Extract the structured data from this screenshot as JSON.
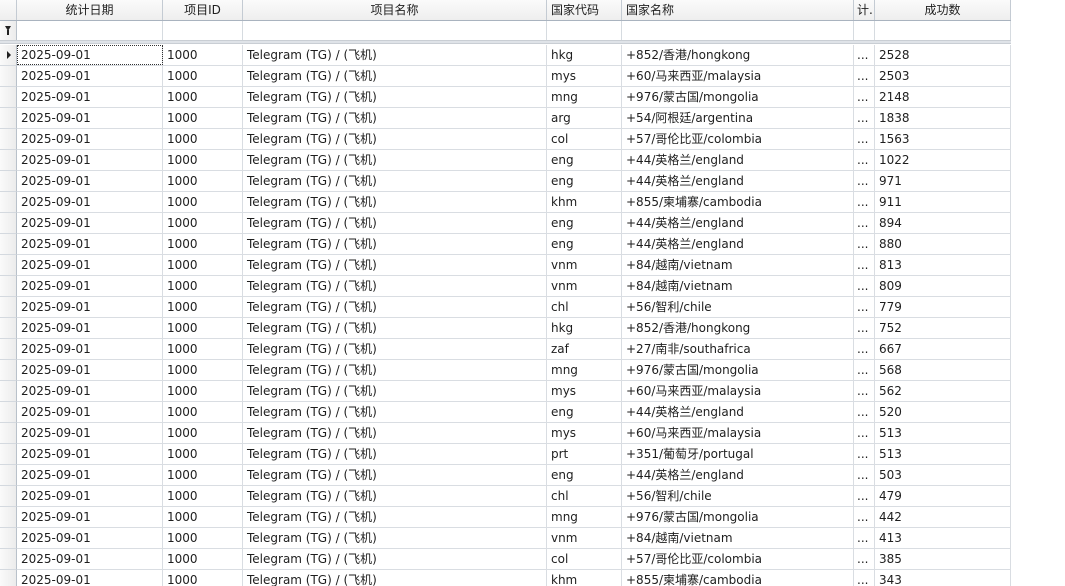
{
  "columns": [
    {
      "key": "date",
      "label": "统计日期"
    },
    {
      "key": "project_id",
      "label": "项目ID"
    },
    {
      "key": "project_name",
      "label": "项目名称"
    },
    {
      "key": "country_code",
      "label": "国家代码"
    },
    {
      "key": "country_name",
      "label": "国家名称"
    },
    {
      "key": "extra",
      "label": "计.."
    },
    {
      "key": "success",
      "label": "成功数"
    }
  ],
  "rows": [
    {
      "date": "2025-09-01",
      "project_id": "1000",
      "project_name": "Telegram (TG) / (飞机)",
      "country_code": "hkg",
      "country_name": "+852/香港/hongkong",
      "extra": "...",
      "success": "2528"
    },
    {
      "date": "2025-09-01",
      "project_id": "1000",
      "project_name": "Telegram (TG) / (飞机)",
      "country_code": "mys",
      "country_name": "+60/马来西亚/malaysia",
      "extra": "...",
      "success": "2503"
    },
    {
      "date": "2025-09-01",
      "project_id": "1000",
      "project_name": "Telegram (TG) / (飞机)",
      "country_code": "mng",
      "country_name": "+976/蒙古国/mongolia",
      "extra": "...",
      "success": "2148"
    },
    {
      "date": "2025-09-01",
      "project_id": "1000",
      "project_name": "Telegram (TG) / (飞机)",
      "country_code": "arg",
      "country_name": "+54/阿根廷/argentina",
      "extra": "...",
      "success": "1838"
    },
    {
      "date": "2025-09-01",
      "project_id": "1000",
      "project_name": "Telegram (TG) / (飞机)",
      "country_code": "col",
      "country_name": "+57/哥伦比亚/colombia",
      "extra": "...",
      "success": "1563"
    },
    {
      "date": "2025-09-01",
      "project_id": "1000",
      "project_name": "Telegram (TG) / (飞机)",
      "country_code": "eng",
      "country_name": "+44/英格兰/england",
      "extra": "...",
      "success": "1022"
    },
    {
      "date": "2025-09-01",
      "project_id": "1000",
      "project_name": "Telegram (TG) / (飞机)",
      "country_code": "eng",
      "country_name": "+44/英格兰/england",
      "extra": "...",
      "success": "971"
    },
    {
      "date": "2025-09-01",
      "project_id": "1000",
      "project_name": "Telegram (TG) / (飞机)",
      "country_code": "khm",
      "country_name": "+855/柬埔寨/cambodia",
      "extra": "...",
      "success": "911"
    },
    {
      "date": "2025-09-01",
      "project_id": "1000",
      "project_name": "Telegram (TG) / (飞机)",
      "country_code": "eng",
      "country_name": "+44/英格兰/england",
      "extra": "...",
      "success": "894"
    },
    {
      "date": "2025-09-01",
      "project_id": "1000",
      "project_name": "Telegram (TG) / (飞机)",
      "country_code": "eng",
      "country_name": "+44/英格兰/england",
      "extra": "...",
      "success": "880"
    },
    {
      "date": "2025-09-01",
      "project_id": "1000",
      "project_name": "Telegram (TG) / (飞机)",
      "country_code": "vnm",
      "country_name": "+84/越南/vietnam",
      "extra": "...",
      "success": "813"
    },
    {
      "date": "2025-09-01",
      "project_id": "1000",
      "project_name": "Telegram (TG) / (飞机)",
      "country_code": "vnm",
      "country_name": "+84/越南/vietnam",
      "extra": "...",
      "success": "809"
    },
    {
      "date": "2025-09-01",
      "project_id": "1000",
      "project_name": "Telegram (TG) / (飞机)",
      "country_code": "chl",
      "country_name": "+56/智利/chile",
      "extra": "...",
      "success": "779"
    },
    {
      "date": "2025-09-01",
      "project_id": "1000",
      "project_name": "Telegram (TG) / (飞机)",
      "country_code": "hkg",
      "country_name": "+852/香港/hongkong",
      "extra": "...",
      "success": "752"
    },
    {
      "date": "2025-09-01",
      "project_id": "1000",
      "project_name": "Telegram (TG) / (飞机)",
      "country_code": "zaf",
      "country_name": "+27/南非/southafrica",
      "extra": "...",
      "success": "667"
    },
    {
      "date": "2025-09-01",
      "project_id": "1000",
      "project_name": "Telegram (TG) / (飞机)",
      "country_code": "mng",
      "country_name": "+976/蒙古国/mongolia",
      "extra": "...",
      "success": "568"
    },
    {
      "date": "2025-09-01",
      "project_id": "1000",
      "project_name": "Telegram (TG) / (飞机)",
      "country_code": "mys",
      "country_name": "+60/马来西亚/malaysia",
      "extra": "...",
      "success": "562"
    },
    {
      "date": "2025-09-01",
      "project_id": "1000",
      "project_name": "Telegram (TG) / (飞机)",
      "country_code": "eng",
      "country_name": "+44/英格兰/england",
      "extra": "...",
      "success": "520"
    },
    {
      "date": "2025-09-01",
      "project_id": "1000",
      "project_name": "Telegram (TG) / (飞机)",
      "country_code": "mys",
      "country_name": "+60/马来西亚/malaysia",
      "extra": "...",
      "success": "513"
    },
    {
      "date": "2025-09-01",
      "project_id": "1000",
      "project_name": "Telegram (TG) / (飞机)",
      "country_code": "prt",
      "country_name": "+351/葡萄牙/portugal",
      "extra": "...",
      "success": "513"
    },
    {
      "date": "2025-09-01",
      "project_id": "1000",
      "project_name": "Telegram (TG) / (飞机)",
      "country_code": "eng",
      "country_name": "+44/英格兰/england",
      "extra": "...",
      "success": "503"
    },
    {
      "date": "2025-09-01",
      "project_id": "1000",
      "project_name": "Telegram (TG) / (飞机)",
      "country_code": "chl",
      "country_name": "+56/智利/chile",
      "extra": "...",
      "success": "479"
    },
    {
      "date": "2025-09-01",
      "project_id": "1000",
      "project_name": "Telegram (TG) / (飞机)",
      "country_code": "mng",
      "country_name": "+976/蒙古国/mongolia",
      "extra": "...",
      "success": "442"
    },
    {
      "date": "2025-09-01",
      "project_id": "1000",
      "project_name": "Telegram (TG) / (飞机)",
      "country_code": "vnm",
      "country_name": "+84/越南/vietnam",
      "extra": "...",
      "success": "413"
    },
    {
      "date": "2025-09-01",
      "project_id": "1000",
      "project_name": "Telegram (TG) / (飞机)",
      "country_code": "col",
      "country_name": "+57/哥伦比亚/colombia",
      "extra": "...",
      "success": "385"
    },
    {
      "date": "2025-09-01",
      "project_id": "1000",
      "project_name": "Telegram (TG) / (飞机)",
      "country_code": "khm",
      "country_name": "+855/柬埔寨/cambodia",
      "extra": "...",
      "success": "343"
    }
  ],
  "icons": {
    "filter_row": "filter-funnel-icon",
    "current_row": "current-row-arrow-icon"
  },
  "colors": {
    "header_bg": "#eeeeee",
    "grid_line": "#d9dde2",
    "indicator_bg": "#ececec"
  }
}
